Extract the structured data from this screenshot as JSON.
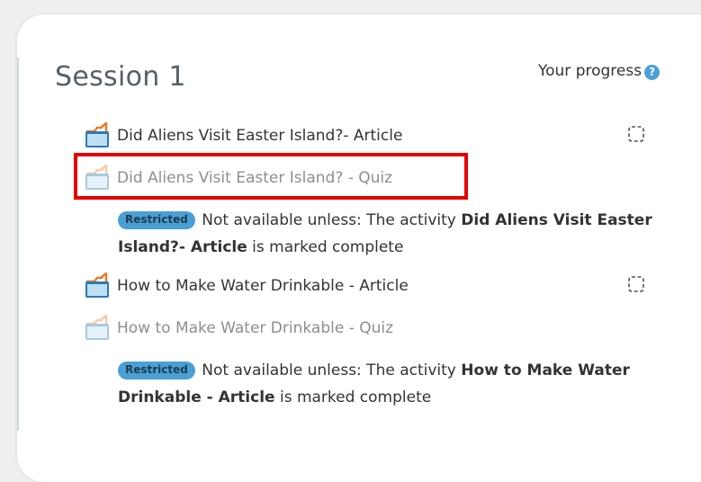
{
  "section": {
    "title": "Session 1",
    "progress_label": "Your progress",
    "help_glyph": "?"
  },
  "activities": [
    {
      "name": "Did Aliens Visit Easter Island?- Article",
      "icon": "page-icon",
      "dimmed": false,
      "has_checkbox": true
    },
    {
      "name": "Did Aliens Visit Easter Island? - Quiz",
      "icon": "page-icon",
      "dimmed": true,
      "has_checkbox": false,
      "restriction": {
        "badge": "Restricted",
        "prefix": "Not available unless: The activity ",
        "activity": "Did Aliens Visit Easter Island?- Article",
        "suffix": " is marked complete"
      }
    },
    {
      "name": "How to Make Water Drinkable - Article",
      "icon": "page-icon",
      "dimmed": false,
      "has_checkbox": true
    },
    {
      "name": "How to Make Water Drinkable - Quiz",
      "icon": "page-icon",
      "dimmed": true,
      "has_checkbox": false,
      "restriction": {
        "badge": "Restricted",
        "prefix": "Not available unless: The activity ",
        "activity": "How to Make Water Drinkable - Article",
        "suffix": " is marked complete"
      }
    }
  ],
  "colors": {
    "accent": "#4aa0d5",
    "highlight": "#e60000",
    "icon_orange": "#f07b22",
    "icon_blue": "#2a7ab8"
  }
}
